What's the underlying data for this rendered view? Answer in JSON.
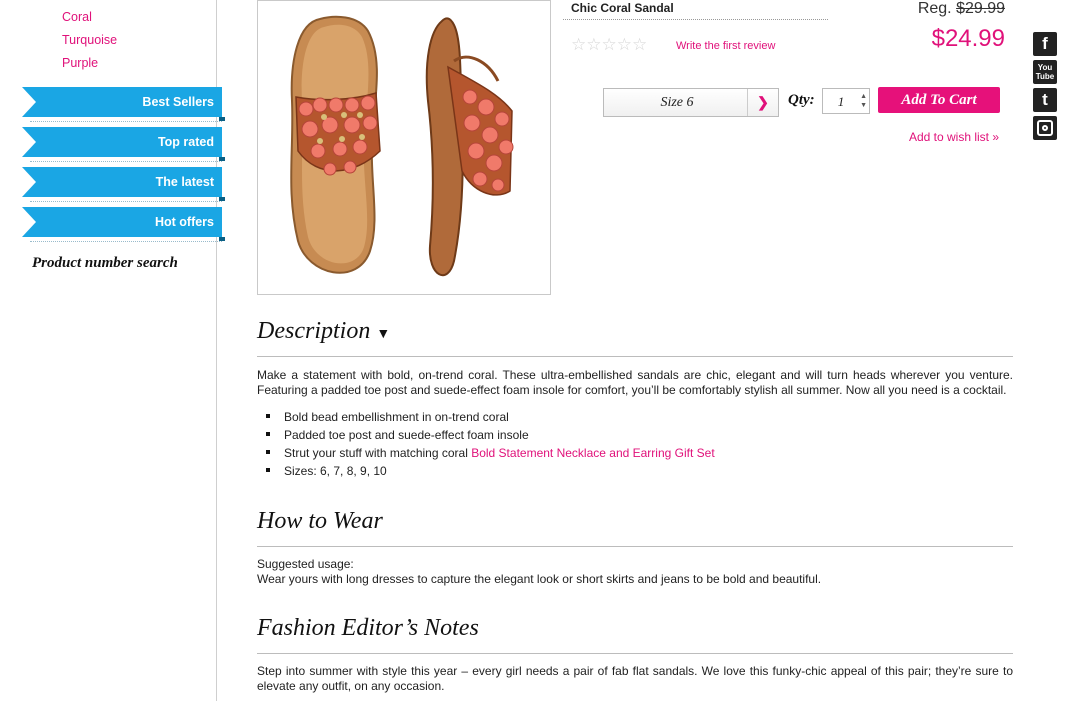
{
  "sidebar": {
    "colors": [
      "Coral",
      "Turquoise",
      "Purple"
    ],
    "tabs": [
      "Best Sellers",
      "Top rated",
      "The latest",
      "Hot offers"
    ],
    "product_number_search": "Product number search"
  },
  "product": {
    "name": "Chic Coral Sandal",
    "reg_label": "Reg.",
    "reg_price": "$29.99",
    "sale_price": "$24.99",
    "rating_stars": 0,
    "write_review": "Write the first review",
    "size_value": "Size 6",
    "qty_label": "Qty:",
    "qty_value": "1",
    "add_to_cart": "Add To Cart",
    "wish_list": "Add to wish list »"
  },
  "social": [
    "facebook-icon",
    "youtube-icon",
    "twitter-icon",
    "instagram-icon"
  ],
  "social_text": {
    "facebook": "f",
    "youtube_top": "You",
    "youtube_bottom": "Tube",
    "twitter": "t"
  },
  "description": {
    "heading": "Description",
    "toggle": "▼",
    "text": "Make a statement with bold, on-trend coral. These ultra-embellished sandals are chic, elegant and will turn heads wherever you venture. Featuring a padded toe post and suede-effect foam insole for comfort, you’ll be comfortably stylish all summer. Now all you need is a cocktail.",
    "bullets": [
      "Bold bead embellishment in on-trend coral",
      "Padded toe post and suede-effect foam insole",
      "Strut your stuff with matching coral",
      "Sizes: 6, 7, 8, 9, 10"
    ],
    "bullet_link": "Bold Statement Necklace and Earring Gift Set"
  },
  "how_to_wear": {
    "heading": "How to Wear",
    "line1": "Suggested usage:",
    "line2": "Wear yours with long dresses to capture the elegant look or short skirts and jeans to be bold and beautiful."
  },
  "editor_notes": {
    "heading": "Fashion Editor’s Notes",
    "text": "Step into summer with style this year – every girl needs a pair of fab flat sandals. We love this funky-chic appeal of this pair; they’re sure to elevate any outfit, on any occasion."
  },
  "colors": {
    "accent": "#e0117a",
    "tab_blue": "#1aa6e4"
  }
}
